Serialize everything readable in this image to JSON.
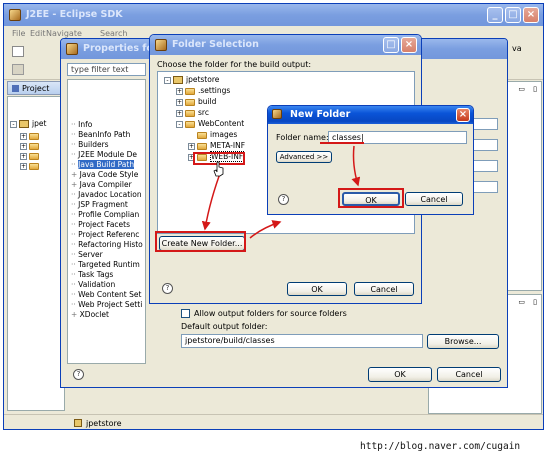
{
  "eclipse": {
    "title": "J2EE - Eclipse SDK",
    "menu": [
      "File",
      "Edit",
      "Navigate",
      "Search"
    ],
    "project_tab": "Project",
    "tree_item": "jpet",
    "status_item": "jpetstore",
    "va_label": "va"
  },
  "properties": {
    "title": "Properties for",
    "filter_placeholder": "type filter text",
    "items": [
      "Info",
      "BeanInfo Path",
      "Builders",
      "J2EE Module De",
      "Java Build Path",
      "Java Code Style",
      "Java Compiler",
      "Javadoc Location",
      "JSP Fragment",
      "Profile Complian",
      "Project Facets",
      "Project Referenc",
      "Refactoring Histo",
      "Server",
      "Targeted Runtim",
      "Task Tags",
      "Validation",
      "Web Content Set",
      "Web Project Setti",
      "XDoclet"
    ],
    "expandable_flags": [
      false,
      false,
      false,
      false,
      false,
      true,
      true,
      false,
      false,
      false,
      false,
      false,
      false,
      false,
      false,
      false,
      false,
      false,
      false,
      true
    ],
    "allow_output_label": "Allow output folders for source folders",
    "default_output_label": "Default output folder:",
    "default_output_value": "jpetstore/build/classes",
    "browse_label": "Browse...",
    "ok_label": "OK",
    "cancel_label": "Cancel"
  },
  "folder_selection": {
    "title": "Folder Selection",
    "instruction": "Choose the folder for the build output:",
    "tree": [
      {
        "label": "jpetstore",
        "level": 0,
        "toggle": "-",
        "icon": "project"
      },
      {
        "label": ".settings",
        "level": 1,
        "toggle": "+",
        "icon": "folder"
      },
      {
        "label": "build",
        "level": 1,
        "toggle": "+",
        "icon": "folder"
      },
      {
        "label": "src",
        "level": 1,
        "toggle": "+",
        "icon": "folder"
      },
      {
        "label": "WebContent",
        "level": 1,
        "toggle": "-",
        "icon": "folder"
      },
      {
        "label": "images",
        "level": 2,
        "toggle": "",
        "icon": "folder"
      },
      {
        "label": "META-INF",
        "level": 2,
        "toggle": "+",
        "icon": "folder"
      },
      {
        "label": "WEB-INF",
        "level": 2,
        "toggle": "+",
        "icon": "folder"
      }
    ],
    "create_new_folder_label": "Create New Folder...",
    "ok_label": "OK",
    "cancel_label": "Cancel"
  },
  "new_folder": {
    "title": "New Folder",
    "folder_name_label": "Folder name:",
    "folder_name_value": "classes",
    "advanced_label": "Advanced >>",
    "ok_label": "OK",
    "cancel_label": "Cancel"
  },
  "watermark": "http://blog.naver.com/cugain",
  "colors": {
    "accent_red": "#d41818",
    "xp_blue": "#0a54d8"
  }
}
